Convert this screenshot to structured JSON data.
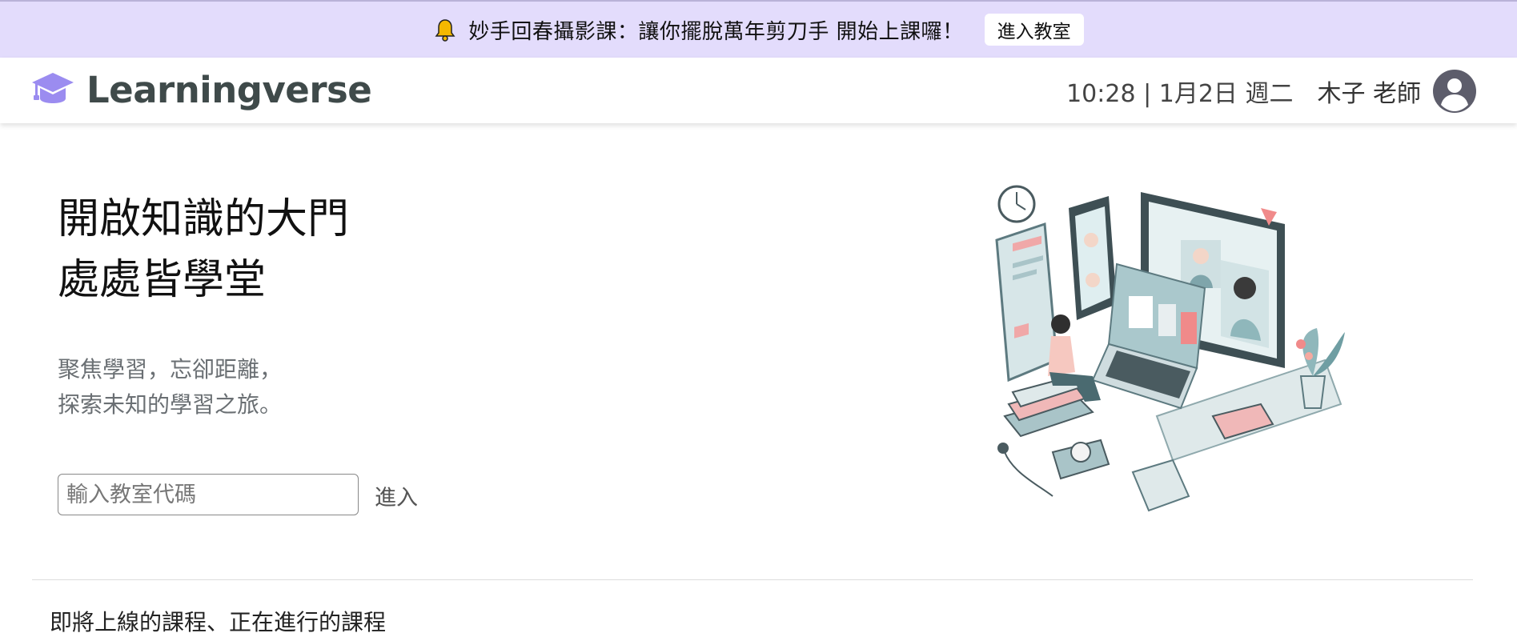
{
  "banner": {
    "text": "妙手回春攝影課：讓你擺脫萬年剪刀手 開始上課囉！",
    "button_label": "進入教室",
    "icon": "bell-icon"
  },
  "header": {
    "brand": "Learningverse",
    "logo_icon": "graduation-cap-icon",
    "datetime": "10:28 | 1月2日 週二",
    "teacher_name": "木子 老師",
    "avatar_icon": "user-circle-icon"
  },
  "hero": {
    "title_line1": "開啟知識的大門",
    "title_line2": "處處皆學堂",
    "subtitle_line1": "聚焦學習，忘卻距離，",
    "subtitle_line2": "探索未知的學習之旅。",
    "code_placeholder": "輸入教室代碼",
    "enter_label": "進入"
  },
  "section": {
    "title": "即將上線的課程、正在進行的課程"
  },
  "colors": {
    "banner_bg": "#e3dcfc",
    "logo_purple": "#9b8cf0",
    "brand_text": "#3f4a4a",
    "avatar": "#5d5d6b"
  }
}
